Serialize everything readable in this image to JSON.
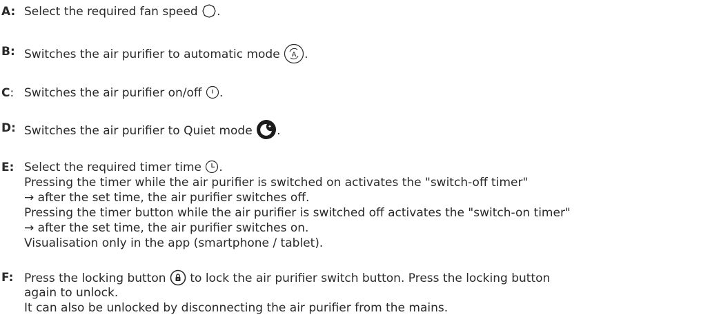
{
  "items": [
    {
      "letter": "A:",
      "text": "Select the required fan speed",
      "end": "."
    },
    {
      "letter": "B:",
      "text": "Switches the air purifier to automatic mode",
      "end": "."
    },
    {
      "letter": "C",
      "colon": ":",
      "text": "Switches the air purifier on/off",
      "end": "."
    },
    {
      "letter": "D:",
      "text": "Switches the air purifier to Quiet mode",
      "end": "."
    },
    {
      "letter": "E:",
      "text": "Select the required timer time",
      "end": ".",
      "lines": [
        "Pressing the timer while the air purifier is switched on activates the \"switch-off timer\"",
        "→ after the set time, the air purifier switches off.",
        "Pressing the timer button while the air purifier is switched off activates the \"switch-on timer\"",
        "→ after the set time, the air purifier switches on.",
        "Visualisation only in the app (smartphone / tablet)."
      ]
    },
    {
      "letter": "F:",
      "text_before": "Press the locking button",
      "text_after": "to lock the air purifier switch button. Press the locking button",
      "lines": [
        "again to unlock.",
        "It can also be unlocked by disconnecting the air purifier from the mains."
      ]
    }
  ],
  "icons": {
    "a": "fan-speed-icon",
    "b": "auto-mode-icon",
    "c": "power-icon",
    "d": "quiet-mode-icon",
    "e": "timer-icon",
    "f": "lock-icon"
  }
}
